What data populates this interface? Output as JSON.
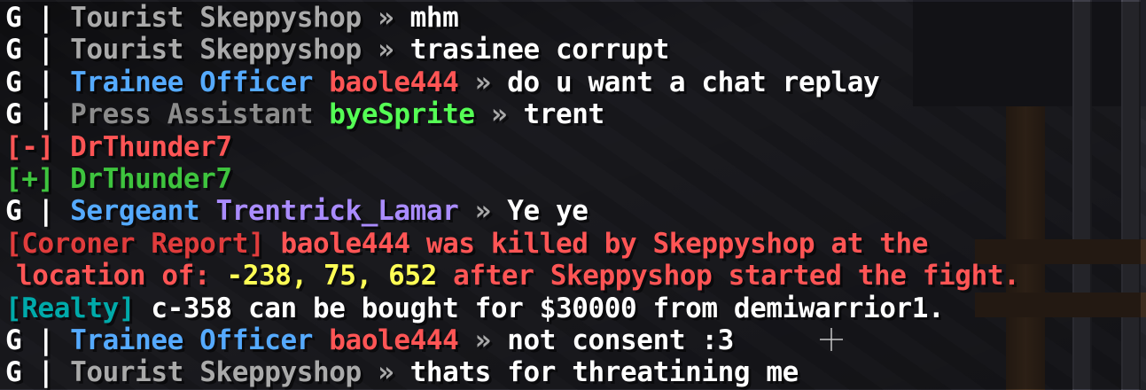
{
  "chat": {
    "lines": [
      {
        "prefix": "G",
        "bar": " | ",
        "rank": "Tourist",
        "name": "Skeppyshop",
        "arrow": " » ",
        "msg": "mhm"
      },
      {
        "prefix": "G",
        "bar": " | ",
        "rank": "Tourist",
        "name": "Skeppyshop",
        "arrow": " » ",
        "msg": "trasinee corrupt"
      },
      {
        "prefix": "G",
        "bar": " | ",
        "rank": "Trainee Officer",
        "name": "baole444",
        "arrow": " » ",
        "msg": "do u want a chat replay"
      },
      {
        "prefix": "G",
        "bar": " | ",
        "rank": "Press Assistant",
        "name": "byeSprite",
        "arrow": " » ",
        "msg": "trent"
      },
      {
        "tag": "[-]",
        "name": "DrThunder7"
      },
      {
        "tag": "[+]",
        "name": "DrThunder7"
      },
      {
        "prefix": "G",
        "bar": " | ",
        "rank": "Sergeant",
        "name": "Trentrick_Lamar",
        "arrow": " » ",
        "msg": "Ye ye"
      },
      {
        "tag": "[Coroner Report]",
        "text": "baole444 was killed by Skeppyshop at the"
      },
      {
        "text_a": "location of: ",
        "coords": "-238, 75, 652",
        "text_b": " after Skeppyshop started the fight."
      },
      {
        "tag": "[Realty]",
        "text": "c-358 can be bought for $30000 from demiwarrior1."
      },
      {
        "prefix": "G",
        "bar": " | ",
        "rank": "Trainee Officer",
        "name": "baole444",
        "arrow": " » ",
        "msg": "not consent :3"
      },
      {
        "prefix": "G",
        "bar": " | ",
        "rank": "Tourist",
        "name": "Skeppyshop",
        "arrow": " » ",
        "msg": "thats for threatining me"
      }
    ]
  },
  "colors": {
    "rank_tourist": "#aaaaaa",
    "rank_trainee_officer": "#55aaff",
    "rank_press_assistant": "#8c8c8c",
    "rank_sergeant": "#55aaff",
    "name_red": "#ff5555",
    "name_green": "#55ff55",
    "name_purple": "#aa8cff",
    "coords": "#ffff55",
    "realty": "#00aaaa"
  }
}
